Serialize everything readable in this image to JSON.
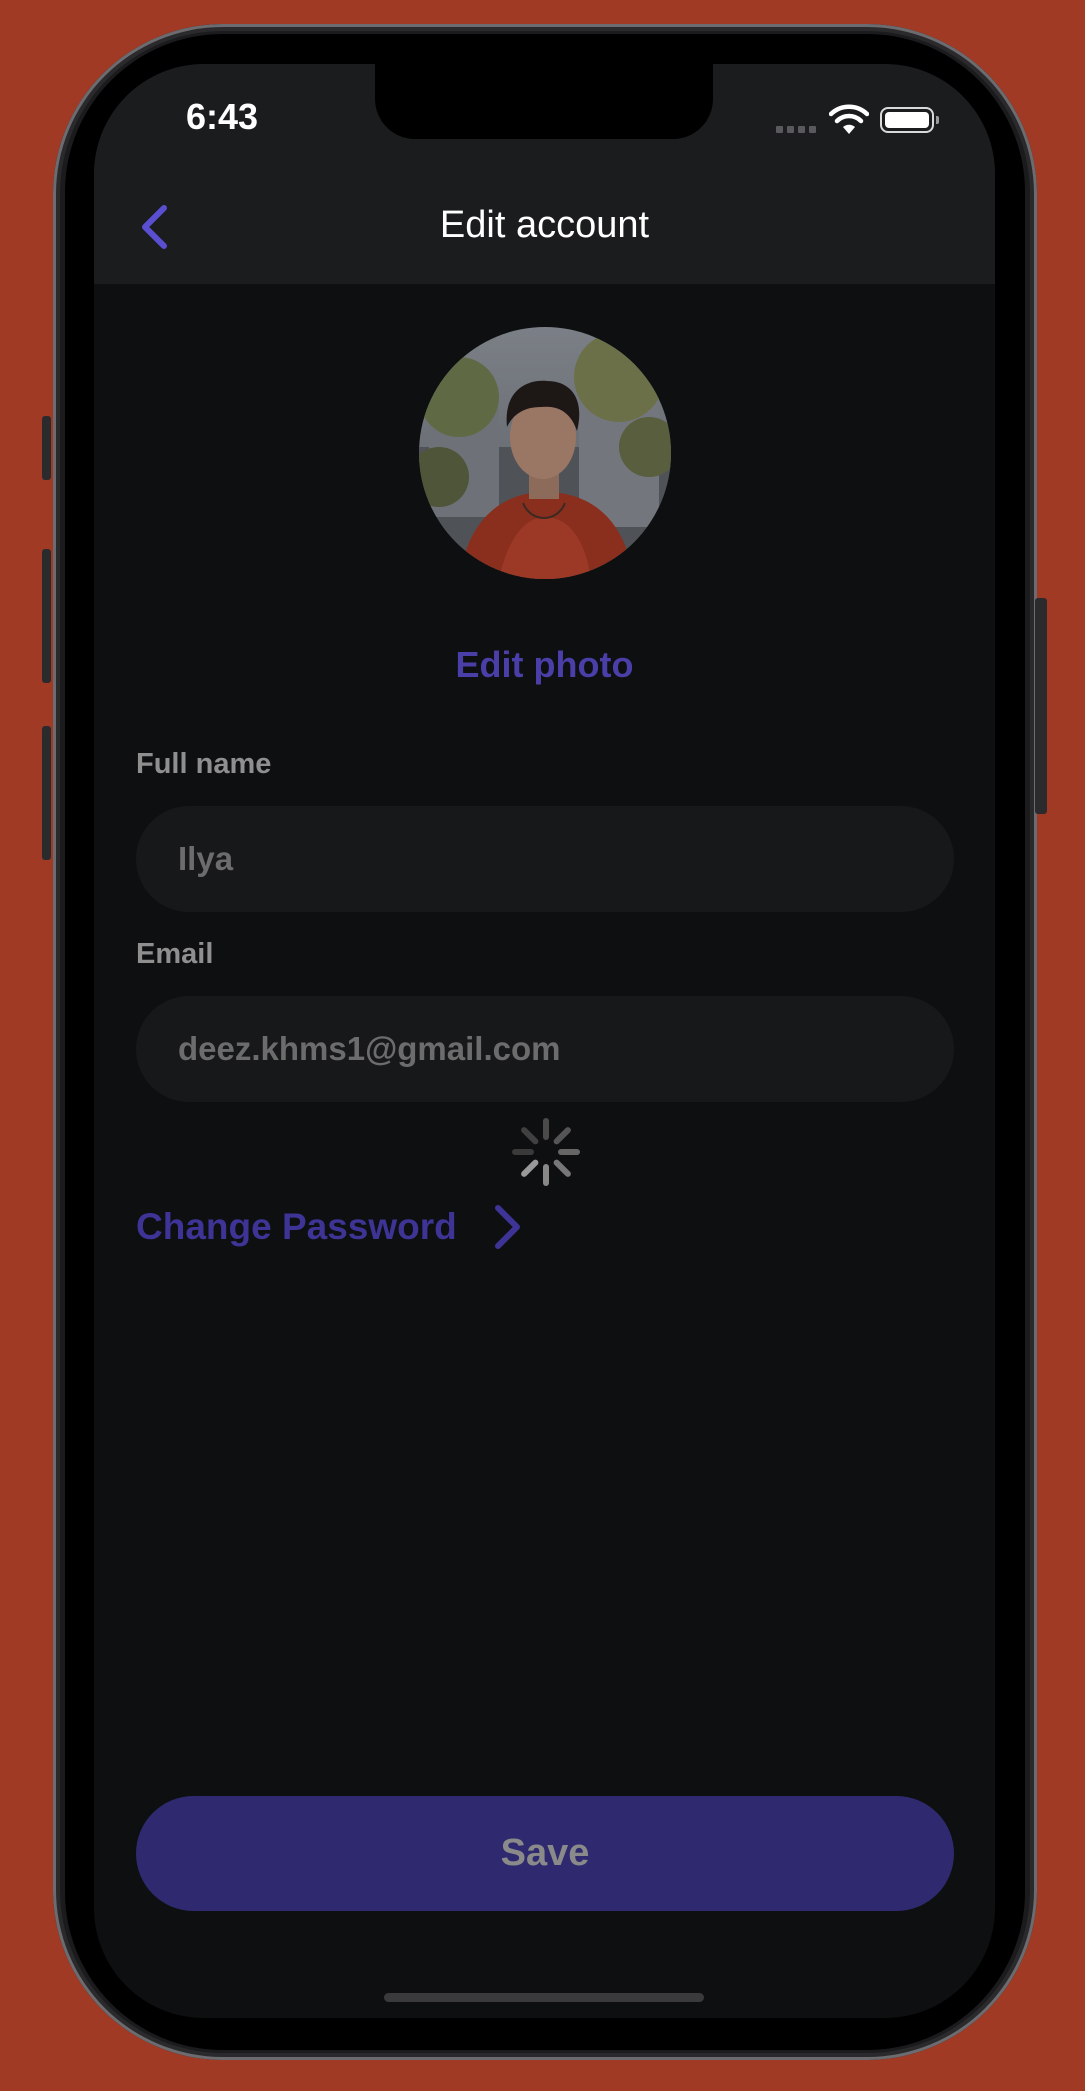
{
  "status_bar": {
    "time": "6:43"
  },
  "header": {
    "title": "Edit account"
  },
  "profile": {
    "edit_photo_label": "Edit photo"
  },
  "form": {
    "full_name": {
      "label": "Full name",
      "value": "Ilya"
    },
    "email": {
      "label": "Email",
      "value": "deez.khms1@gmail.com"
    }
  },
  "change_password": {
    "label": "Change Password"
  },
  "save_button": {
    "label": "Save"
  },
  "colors": {
    "background": "#A03A24",
    "screen": "#0d0f10",
    "header": "#1a1c1e",
    "accent": "#4a3fa8",
    "save_button": "#2f2a6f"
  }
}
